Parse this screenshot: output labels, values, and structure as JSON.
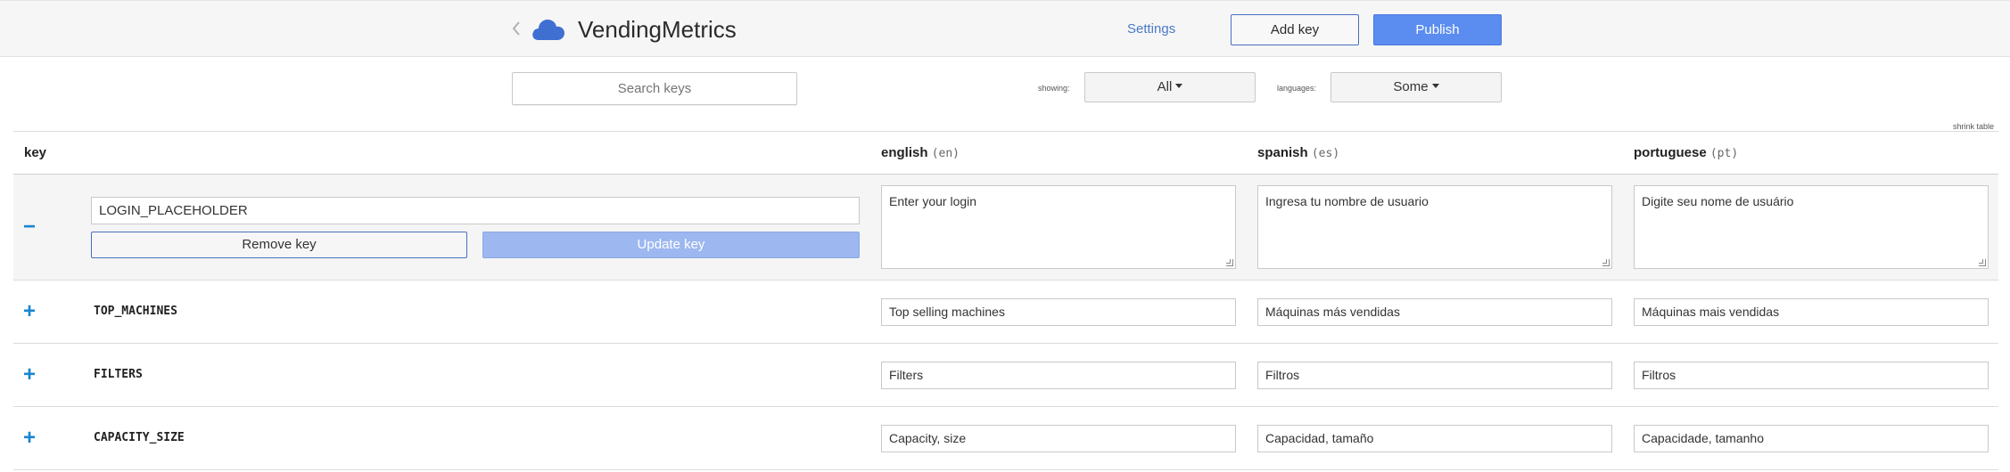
{
  "header": {
    "back_icon": "chevron-left-icon",
    "logo_icon": "cloud-icon",
    "title": "VendingMetrics",
    "settings_label": "Settings",
    "add_key_label": "Add key",
    "publish_label": "Publish",
    "accent_color": "#5b8cef"
  },
  "filters": {
    "search_placeholder": "Search keys",
    "showing_label": "showing:",
    "showing_value": "All",
    "languages_label": "languages:",
    "languages_value": "Some",
    "shrink_label": "shrink table"
  },
  "table": {
    "key_header": "key",
    "columns": [
      {
        "name": "english",
        "code": "(en)"
      },
      {
        "name": "spanish",
        "code": "(es)"
      },
      {
        "name": "portuguese",
        "code": "(pt)"
      }
    ],
    "expanded": {
      "toggle": "−",
      "key_value": "LOGIN_PLACEHOLDER",
      "remove_label": "Remove key",
      "update_label": "Update key",
      "values": [
        "Enter your login",
        "Ingresa tu nombre de usuario",
        "Digite seu nome de usuário"
      ]
    },
    "rows": [
      {
        "toggle": "+",
        "key": "TOP_MACHINES",
        "values": [
          "Top selling machines",
          "Máquinas más vendidas",
          "Máquinas mais vendidas"
        ]
      },
      {
        "toggle": "+",
        "key": "FILTERS",
        "values": [
          "Filters",
          "Filtros",
          "Filtros"
        ]
      },
      {
        "toggle": "+",
        "key": "CAPACITY_SIZE",
        "values": [
          "Capacity, size",
          "Capacidad, tamaño",
          "Capacidade, tamanho"
        ]
      }
    ]
  }
}
